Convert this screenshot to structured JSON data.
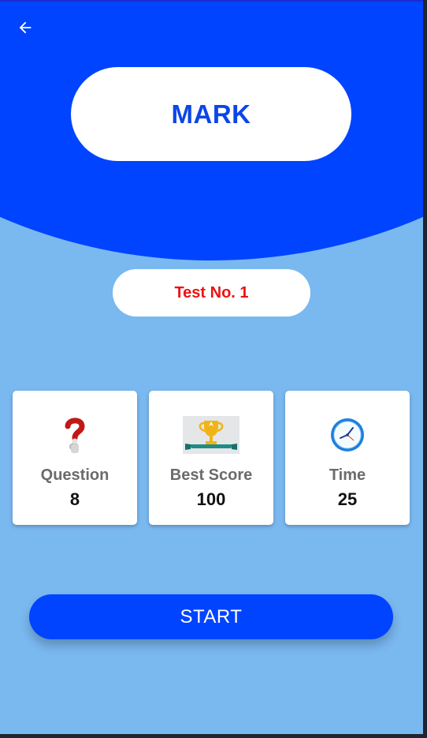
{
  "header": {
    "back_icon": "arrow-left-icon",
    "title": "MARK"
  },
  "test": {
    "label": "Test No. 1"
  },
  "stats": [
    {
      "icon": "question-mark-icon",
      "label": "Question",
      "value": "8"
    },
    {
      "icon": "trophy-award-icon",
      "label": "Best Score",
      "value": "100"
    },
    {
      "icon": "clock-icon",
      "label": "Time",
      "value": "25"
    }
  ],
  "actions": {
    "start_label": "START"
  },
  "colors": {
    "primary": "#0044ff",
    "background": "#7ab8f0",
    "accent_red": "#ee1111",
    "card": "#ffffff"
  }
}
